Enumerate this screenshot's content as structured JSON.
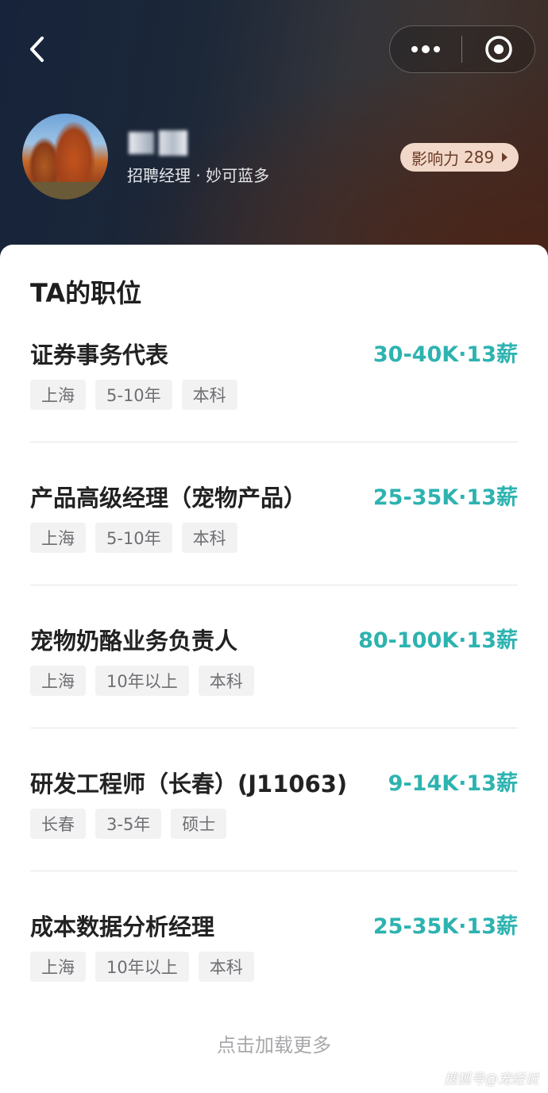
{
  "header": {
    "subtitle": "招聘经理 · 妙可蓝多",
    "influence_label": "影响力",
    "influence_value": "289"
  },
  "section": {
    "title": "TA的职位"
  },
  "jobs": [
    {
      "title": "证券事务代表",
      "salary": "30-40K·13薪",
      "tags": [
        "上海",
        "5-10年",
        "本科"
      ]
    },
    {
      "title": "产品高级经理（宠物产品）",
      "salary": "25-35K·13薪",
      "tags": [
        "上海",
        "5-10年",
        "本科"
      ]
    },
    {
      "title": "宠物奶酪业务负责人",
      "salary": "80-100K·13薪",
      "tags": [
        "上海",
        "10年以上",
        "本科"
      ]
    },
    {
      "title": "研发工程师（长春）(J11063)",
      "salary": "9-14K·13薪",
      "tags": [
        "长春",
        "3-5年",
        "硕士"
      ]
    },
    {
      "title": "成本数据分析经理",
      "salary": "25-35K·13薪",
      "tags": [
        "上海",
        "10年以上",
        "本科"
      ]
    }
  ],
  "load_more": "点击加载更多",
  "watermark": "搜狐号@宠经说",
  "colors": {
    "accent_salary": "#2db3b0",
    "influence_bg": "#f1d8c8"
  },
  "icons": {
    "back": "chevron-left-icon",
    "more": "more-dots-icon",
    "close": "target-close-icon"
  }
}
